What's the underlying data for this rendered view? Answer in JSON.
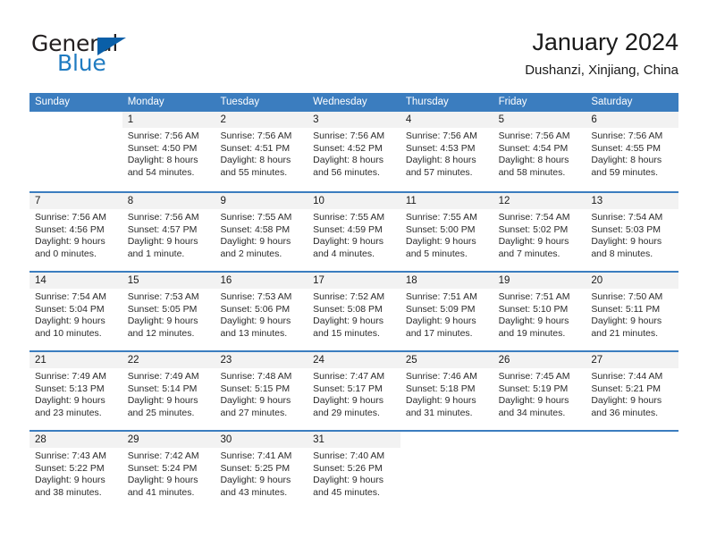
{
  "brand": {
    "name_part1": "General",
    "name_part2": "Blue"
  },
  "header": {
    "title": "January 2024",
    "subtitle": "Dushanzi, Xinjiang, China"
  },
  "colors": {
    "header_blue": "#3b7dbf",
    "logo_blue": "#1f7bc1",
    "triangle_blue": "#0a5fa8",
    "daynum_bg": "#f2f2f2"
  },
  "weekdays": [
    "Sunday",
    "Monday",
    "Tuesday",
    "Wednesday",
    "Thursday",
    "Friday",
    "Saturday"
  ],
  "weeks": [
    [
      {
        "day": "",
        "sunrise": "",
        "sunset": "",
        "daylight": ""
      },
      {
        "day": "1",
        "sunrise": "Sunrise: 7:56 AM",
        "sunset": "Sunset: 4:50 PM",
        "daylight": "Daylight: 8 hours and 54 minutes."
      },
      {
        "day": "2",
        "sunrise": "Sunrise: 7:56 AM",
        "sunset": "Sunset: 4:51 PM",
        "daylight": "Daylight: 8 hours and 55 minutes."
      },
      {
        "day": "3",
        "sunrise": "Sunrise: 7:56 AM",
        "sunset": "Sunset: 4:52 PM",
        "daylight": "Daylight: 8 hours and 56 minutes."
      },
      {
        "day": "4",
        "sunrise": "Sunrise: 7:56 AM",
        "sunset": "Sunset: 4:53 PM",
        "daylight": "Daylight: 8 hours and 57 minutes."
      },
      {
        "day": "5",
        "sunrise": "Sunrise: 7:56 AM",
        "sunset": "Sunset: 4:54 PM",
        "daylight": "Daylight: 8 hours and 58 minutes."
      },
      {
        "day": "6",
        "sunrise": "Sunrise: 7:56 AM",
        "sunset": "Sunset: 4:55 PM",
        "daylight": "Daylight: 8 hours and 59 minutes."
      }
    ],
    [
      {
        "day": "7",
        "sunrise": "Sunrise: 7:56 AM",
        "sunset": "Sunset: 4:56 PM",
        "daylight": "Daylight: 9 hours and 0 minutes."
      },
      {
        "day": "8",
        "sunrise": "Sunrise: 7:56 AM",
        "sunset": "Sunset: 4:57 PM",
        "daylight": "Daylight: 9 hours and 1 minute."
      },
      {
        "day": "9",
        "sunrise": "Sunrise: 7:55 AM",
        "sunset": "Sunset: 4:58 PM",
        "daylight": "Daylight: 9 hours and 2 minutes."
      },
      {
        "day": "10",
        "sunrise": "Sunrise: 7:55 AM",
        "sunset": "Sunset: 4:59 PM",
        "daylight": "Daylight: 9 hours and 4 minutes."
      },
      {
        "day": "11",
        "sunrise": "Sunrise: 7:55 AM",
        "sunset": "Sunset: 5:00 PM",
        "daylight": "Daylight: 9 hours and 5 minutes."
      },
      {
        "day": "12",
        "sunrise": "Sunrise: 7:54 AM",
        "sunset": "Sunset: 5:02 PM",
        "daylight": "Daylight: 9 hours and 7 minutes."
      },
      {
        "day": "13",
        "sunrise": "Sunrise: 7:54 AM",
        "sunset": "Sunset: 5:03 PM",
        "daylight": "Daylight: 9 hours and 8 minutes."
      }
    ],
    [
      {
        "day": "14",
        "sunrise": "Sunrise: 7:54 AM",
        "sunset": "Sunset: 5:04 PM",
        "daylight": "Daylight: 9 hours and 10 minutes."
      },
      {
        "day": "15",
        "sunrise": "Sunrise: 7:53 AM",
        "sunset": "Sunset: 5:05 PM",
        "daylight": "Daylight: 9 hours and 12 minutes."
      },
      {
        "day": "16",
        "sunrise": "Sunrise: 7:53 AM",
        "sunset": "Sunset: 5:06 PM",
        "daylight": "Daylight: 9 hours and 13 minutes."
      },
      {
        "day": "17",
        "sunrise": "Sunrise: 7:52 AM",
        "sunset": "Sunset: 5:08 PM",
        "daylight": "Daylight: 9 hours and 15 minutes."
      },
      {
        "day": "18",
        "sunrise": "Sunrise: 7:51 AM",
        "sunset": "Sunset: 5:09 PM",
        "daylight": "Daylight: 9 hours and 17 minutes."
      },
      {
        "day": "19",
        "sunrise": "Sunrise: 7:51 AM",
        "sunset": "Sunset: 5:10 PM",
        "daylight": "Daylight: 9 hours and 19 minutes."
      },
      {
        "day": "20",
        "sunrise": "Sunrise: 7:50 AM",
        "sunset": "Sunset: 5:11 PM",
        "daylight": "Daylight: 9 hours and 21 minutes."
      }
    ],
    [
      {
        "day": "21",
        "sunrise": "Sunrise: 7:49 AM",
        "sunset": "Sunset: 5:13 PM",
        "daylight": "Daylight: 9 hours and 23 minutes."
      },
      {
        "day": "22",
        "sunrise": "Sunrise: 7:49 AM",
        "sunset": "Sunset: 5:14 PM",
        "daylight": "Daylight: 9 hours and 25 minutes."
      },
      {
        "day": "23",
        "sunrise": "Sunrise: 7:48 AM",
        "sunset": "Sunset: 5:15 PM",
        "daylight": "Daylight: 9 hours and 27 minutes."
      },
      {
        "day": "24",
        "sunrise": "Sunrise: 7:47 AM",
        "sunset": "Sunset: 5:17 PM",
        "daylight": "Daylight: 9 hours and 29 minutes."
      },
      {
        "day": "25",
        "sunrise": "Sunrise: 7:46 AM",
        "sunset": "Sunset: 5:18 PM",
        "daylight": "Daylight: 9 hours and 31 minutes."
      },
      {
        "day": "26",
        "sunrise": "Sunrise: 7:45 AM",
        "sunset": "Sunset: 5:19 PM",
        "daylight": "Daylight: 9 hours and 34 minutes."
      },
      {
        "day": "27",
        "sunrise": "Sunrise: 7:44 AM",
        "sunset": "Sunset: 5:21 PM",
        "daylight": "Daylight: 9 hours and 36 minutes."
      }
    ],
    [
      {
        "day": "28",
        "sunrise": "Sunrise: 7:43 AM",
        "sunset": "Sunset: 5:22 PM",
        "daylight": "Daylight: 9 hours and 38 minutes."
      },
      {
        "day": "29",
        "sunrise": "Sunrise: 7:42 AM",
        "sunset": "Sunset: 5:24 PM",
        "daylight": "Daylight: 9 hours and 41 minutes."
      },
      {
        "day": "30",
        "sunrise": "Sunrise: 7:41 AM",
        "sunset": "Sunset: 5:25 PM",
        "daylight": "Daylight: 9 hours and 43 minutes."
      },
      {
        "day": "31",
        "sunrise": "Sunrise: 7:40 AM",
        "sunset": "Sunset: 5:26 PM",
        "daylight": "Daylight: 9 hours and 45 minutes."
      },
      {
        "day": "",
        "sunrise": "",
        "sunset": "",
        "daylight": ""
      },
      {
        "day": "",
        "sunrise": "",
        "sunset": "",
        "daylight": ""
      },
      {
        "day": "",
        "sunrise": "",
        "sunset": "",
        "daylight": ""
      }
    ]
  ]
}
